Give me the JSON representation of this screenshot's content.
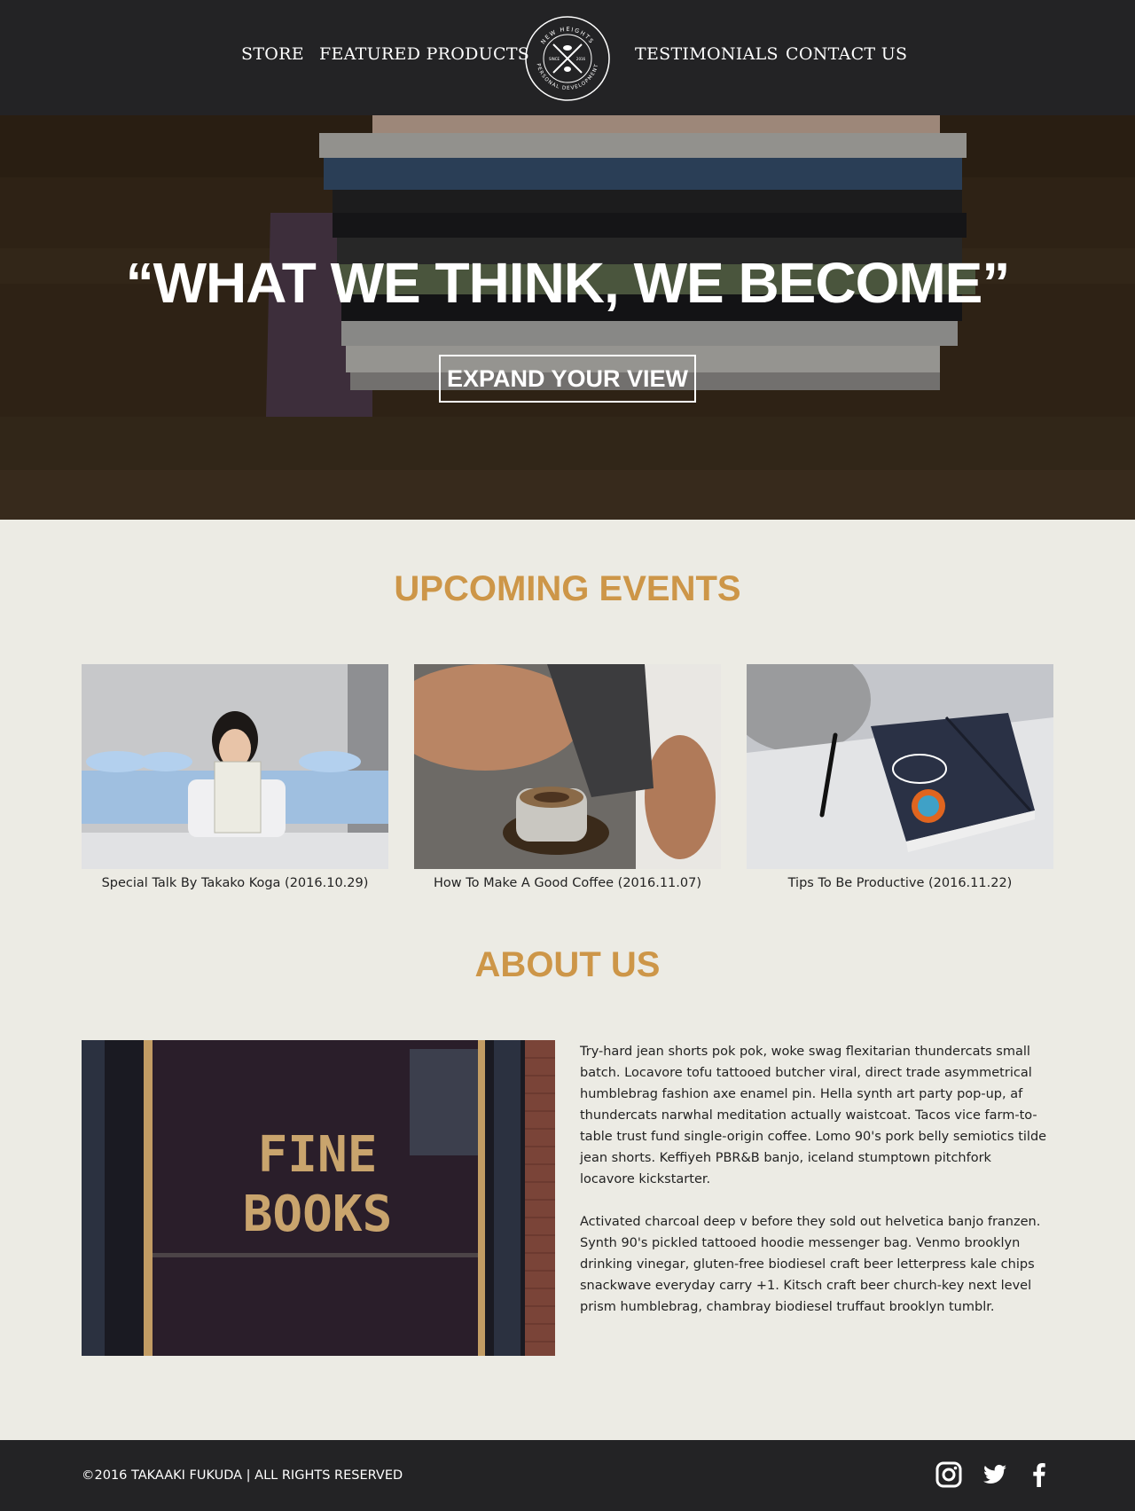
{
  "header": {
    "nav_left": [
      "STORE",
      "FEATURED PRODUCTS"
    ],
    "nav_right": [
      "TESTIMONIALS",
      "CONTACT US"
    ],
    "logo": {
      "top_text": "NEW HEIGHTS",
      "bottom_text": "PERSONAL DEVELOPMENT",
      "left_text": "SINCE",
      "right_text": "2016"
    }
  },
  "hero": {
    "quote": "“WHAT WE THINK, WE BECOME”",
    "button_label": "EXPAND YOUR VIEW"
  },
  "events": {
    "title": "UPCOMING EVENTS",
    "items": [
      {
        "caption": "Special Talk By Takako Koga (2016.10.29)"
      },
      {
        "caption": "How To Make A Good Coffee (2016.11.07)"
      },
      {
        "caption": "Tips To Be Productive (2016.11.22)"
      }
    ]
  },
  "about": {
    "title": "ABOUT US",
    "image_text": [
      "FINE",
      "BOOKS"
    ],
    "paragraphs": [
      "Try-hard jean shorts pok pok, woke swag flexitarian thundercats small batch. Locavore tofu tattooed butcher viral, direct trade asymmetrical humblebrag fashion axe enamel pin. Hella synth art party pop-up, af thundercats narwhal meditation actually waistcoat. Tacos vice farm-to-table trust fund single-origin coffee. Lomo 90's pork belly semiotics tilde jean shorts. Keffiyeh PBR&B banjo, iceland stumptown pitchfork locavore kickstarter.",
      "Activated charcoal deep v before they sold out helvetica banjo franzen. Synth 90's pickled tattooed hoodie messenger bag. Venmo brooklyn drinking vinegar, gluten-free biodiesel craft beer letterpress kale chips snackwave everyday carry +1. Kitsch craft beer church-key next level prism humblebrag, chambray biodiesel truffaut brooklyn tumblr."
    ]
  },
  "footer": {
    "copyright": "©2016 TAKAAKI FUKUDA | ALL RIGHTS RESERVED",
    "social_icons": [
      "instagram-icon",
      "twitter-icon",
      "facebook-icon"
    ]
  },
  "colors": {
    "dark": "#232325",
    "accent": "#cd9648",
    "background": "#ecebe4"
  }
}
